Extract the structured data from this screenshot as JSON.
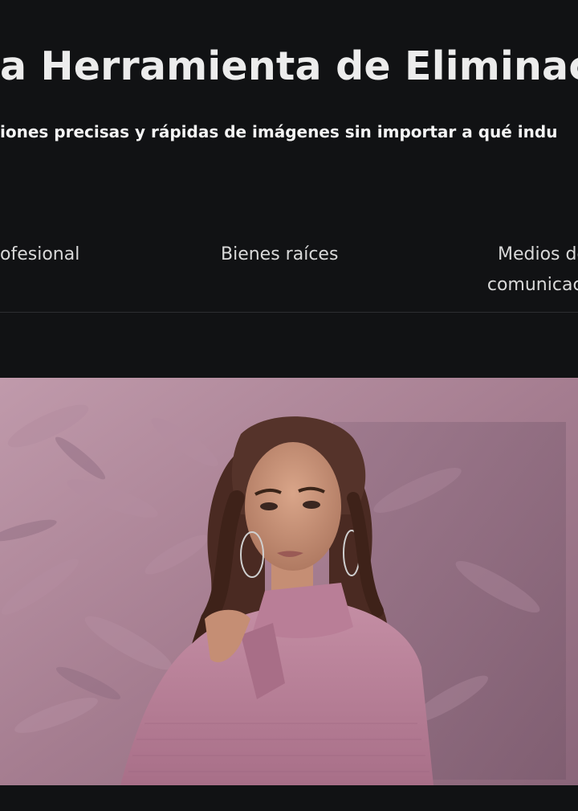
{
  "hero": {
    "title": "a Herramienta de Eliminació",
    "subtitle": "iones precisas y rápidas de imágenes sin importar a qué indu"
  },
  "tabs": [
    {
      "label": "ofesional"
    },
    {
      "label": "Bienes raíces"
    },
    {
      "label_line1": "Medios de",
      "label_line2": "comunicació"
    }
  ],
  "image": {
    "subject": "woman-in-pink-sweater-photo"
  }
}
